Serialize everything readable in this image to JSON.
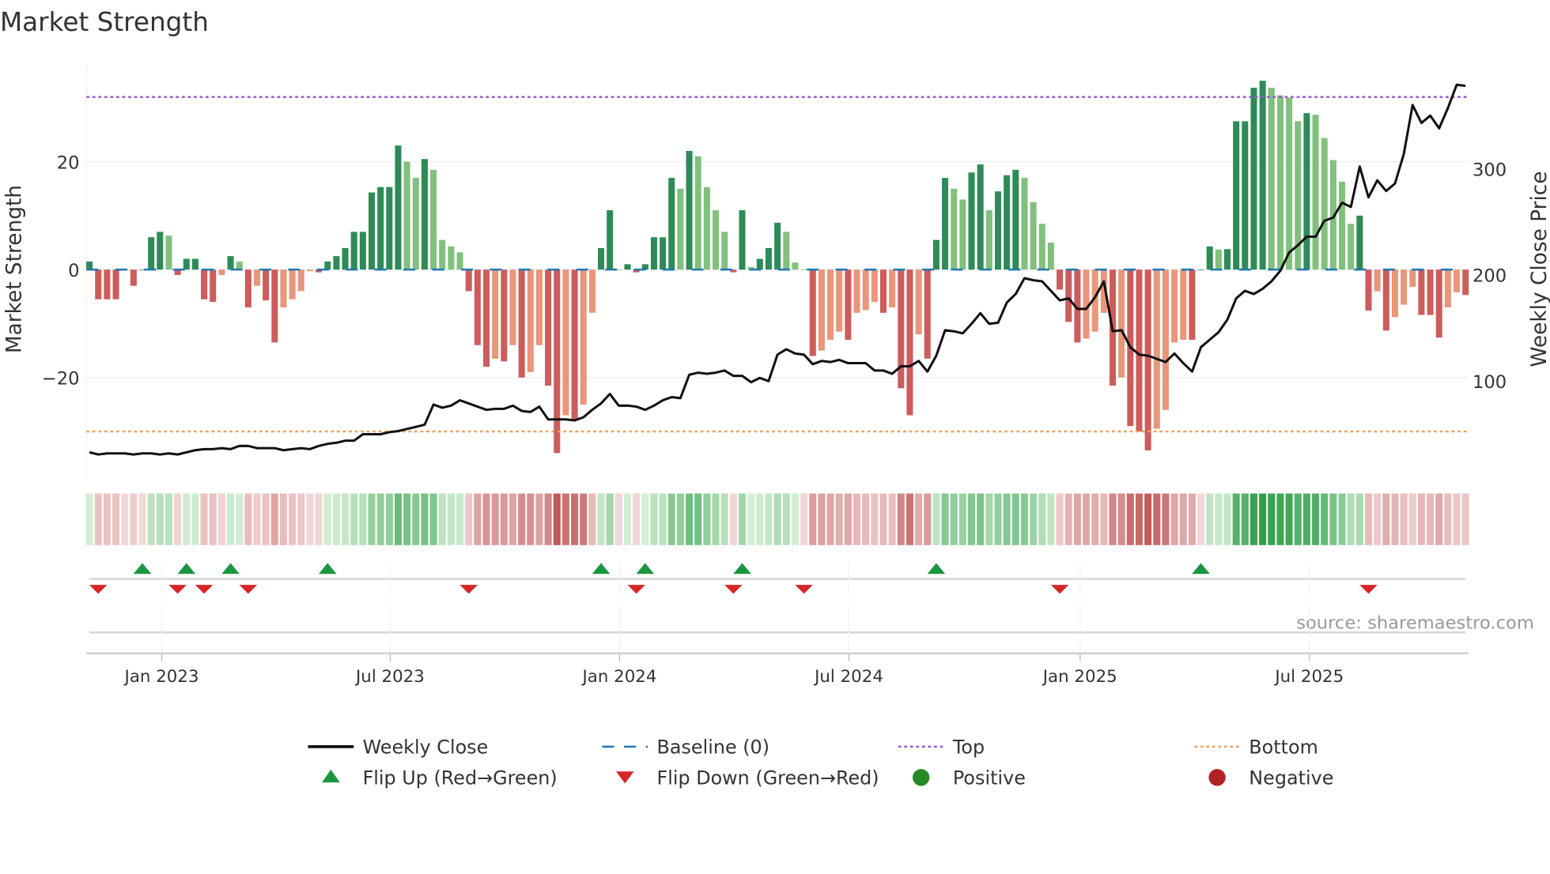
{
  "chart_data": {
    "type": "bar",
    "title": "Market Strength",
    "ylabel": "Market Strength",
    "y2label": "Weekly Close Price",
    "ylim": [
      -38,
      38
    ],
    "y2lim": [
      12,
      398
    ],
    "yticks": [
      -20,
      0,
      20
    ],
    "yticklabels": [
      "−20",
      "0",
      "20"
    ],
    "y2ticks": [
      100,
      200,
      300
    ],
    "y2ticklabels": [
      "100",
      "200",
      "300"
    ],
    "top_level": 32,
    "bottom_level": -30,
    "xticks": [
      {
        "week": 8.2,
        "label": "Jan 2023"
      },
      {
        "week": 34.1,
        "label": "Jul 2023"
      },
      {
        "week": 60.1,
        "label": "Jan 2024"
      },
      {
        "week": 86.1,
        "label": "Jul 2024"
      },
      {
        "week": 112.3,
        "label": "Jan 2025"
      },
      {
        "week": 138.3,
        "label": "Jul 2025"
      }
    ],
    "strength": [
      1.5,
      -5.5,
      -5.5,
      -5.5,
      0,
      -3,
      0,
      6,
      7,
      6.3,
      -1,
      2,
      2,
      -5.5,
      -6,
      -1,
      2.5,
      1.5,
      -7,
      -3,
      -5.7,
      -13.5,
      -7,
      -5.5,
      -4,
      -0.3,
      -0.5,
      1.5,
      2.5,
      4,
      7,
      7,
      14.3,
      15.3,
      15.3,
      23,
      20,
      17,
      20.5,
      18.5,
      5.5,
      4.3,
      3.2,
      -4,
      -14,
      -18,
      -16.5,
      -17,
      -14,
      -20,
      -19,
      -14,
      -21.5,
      -34,
      -27,
      -28,
      -25,
      -8,
      4,
      11,
      0,
      1,
      -0.5,
      1,
      6,
      6,
      17,
      15,
      22,
      21,
      15.3,
      11,
      7,
      -0.5,
      11,
      0.5,
      2,
      4,
      8.7,
      7,
      1.3,
      0,
      -16,
      -15,
      -13,
      -11.5,
      -13,
      -8,
      -7.5,
      -6,
      -8,
      -7,
      -22,
      -27,
      -12,
      -16.5,
      5.5,
      17,
      15,
      13,
      18,
      19.5,
      11,
      14.5,
      17.5,
      18.5,
      17,
      12.5,
      8.5,
      5,
      -3.7,
      -9.7,
      -13.5,
      -12.8,
      -11.5,
      -8,
      -21.5,
      -20,
      -29,
      -30,
      -33.5,
      -29.5,
      -26,
      -13.5,
      -13,
      -13,
      0,
      4.3,
      3.7,
      3.8,
      27.5,
      27.5,
      33.7,
      35,
      33.7,
      32.3,
      31.9,
      27.5,
      29,
      28.7,
      24.4,
      20.3,
      16.3,
      8.5,
      10,
      -7.6,
      -4,
      -11.3,
      -8.8,
      -6.5,
      -3.2,
      -8.4,
      -8.4,
      -12.6,
      -7,
      -4.2,
      -4.7
    ],
    "weekly_close": [
      33,
      31,
      32,
      32,
      32,
      31,
      32,
      32,
      31,
      32,
      31,
      33,
      35,
      36,
      36,
      37,
      36,
      39,
      39,
      37,
      37,
      37,
      35,
      36,
      37,
      36,
      39,
      41,
      42,
      44,
      44,
      50,
      50,
      50,
      52,
      53,
      55,
      57,
      59,
      78,
      75,
      77,
      82,
      79,
      76,
      73,
      74,
      74,
      77,
      72,
      71,
      76,
      64,
      64,
      64,
      63,
      66,
      73,
      79,
      88,
      77,
      77,
      76,
      73,
      77,
      82,
      85,
      84,
      106,
      108,
      107,
      108,
      110,
      105,
      105,
      99,
      103,
      100,
      125,
      130,
      126,
      125,
      116,
      119,
      118,
      120,
      117,
      117,
      117,
      110,
      110,
      107,
      114,
      114,
      119,
      109,
      124,
      148,
      147,
      145,
      154,
      164,
      154,
      155,
      174,
      182,
      197,
      195,
      194,
      185,
      176,
      178,
      168,
      168,
      179,
      194,
      147,
      148,
      132,
      125,
      124,
      121,
      118,
      126,
      117,
      109,
      132,
      139,
      146,
      158,
      178,
      185,
      182,
      187,
      194,
      204,
      221,
      228,
      236,
      236,
      251,
      254,
      268,
      264,
      302,
      273,
      289,
      279,
      286,
      314,
      360,
      343,
      350,
      338,
      357,
      379,
      378
    ],
    "flip_up_weeks": [
      6,
      11,
      16,
      27,
      58,
      63,
      74,
      96,
      126
    ],
    "flip_down_weeks": [
      1,
      10,
      13,
      18,
      43,
      62,
      73,
      81,
      110,
      145
    ],
    "legend": [
      {
        "label": "Weekly Close",
        "kind": "line",
        "color": "#111111"
      },
      {
        "label": "Baseline (0)",
        "kind": "dash",
        "color": "#1f77b4"
      },
      {
        "label": "Top",
        "kind": "dot",
        "color": "#9b59d0"
      },
      {
        "label": "Bottom",
        "kind": "dot",
        "color": "#f0a060"
      },
      {
        "label": "Flip Up (Red→Green)",
        "kind": "up",
        "color": "#1a9641"
      },
      {
        "label": "Flip Down (Green→Red)",
        "kind": "down",
        "color": "#d62728"
      },
      {
        "label": "Positive",
        "kind": "circle",
        "color": "#228b22"
      },
      {
        "label": "Negative",
        "kind": "circle",
        "color": "#b22222"
      }
    ],
    "legend_position": "bottom-center",
    "colors": {
      "pos_dark": "#2e8b57",
      "pos_light": "#82c07e",
      "neg_dark": "#cd5c5c",
      "neg_light": "#e9967a"
    }
  },
  "source": "source: sharemaestro.com"
}
